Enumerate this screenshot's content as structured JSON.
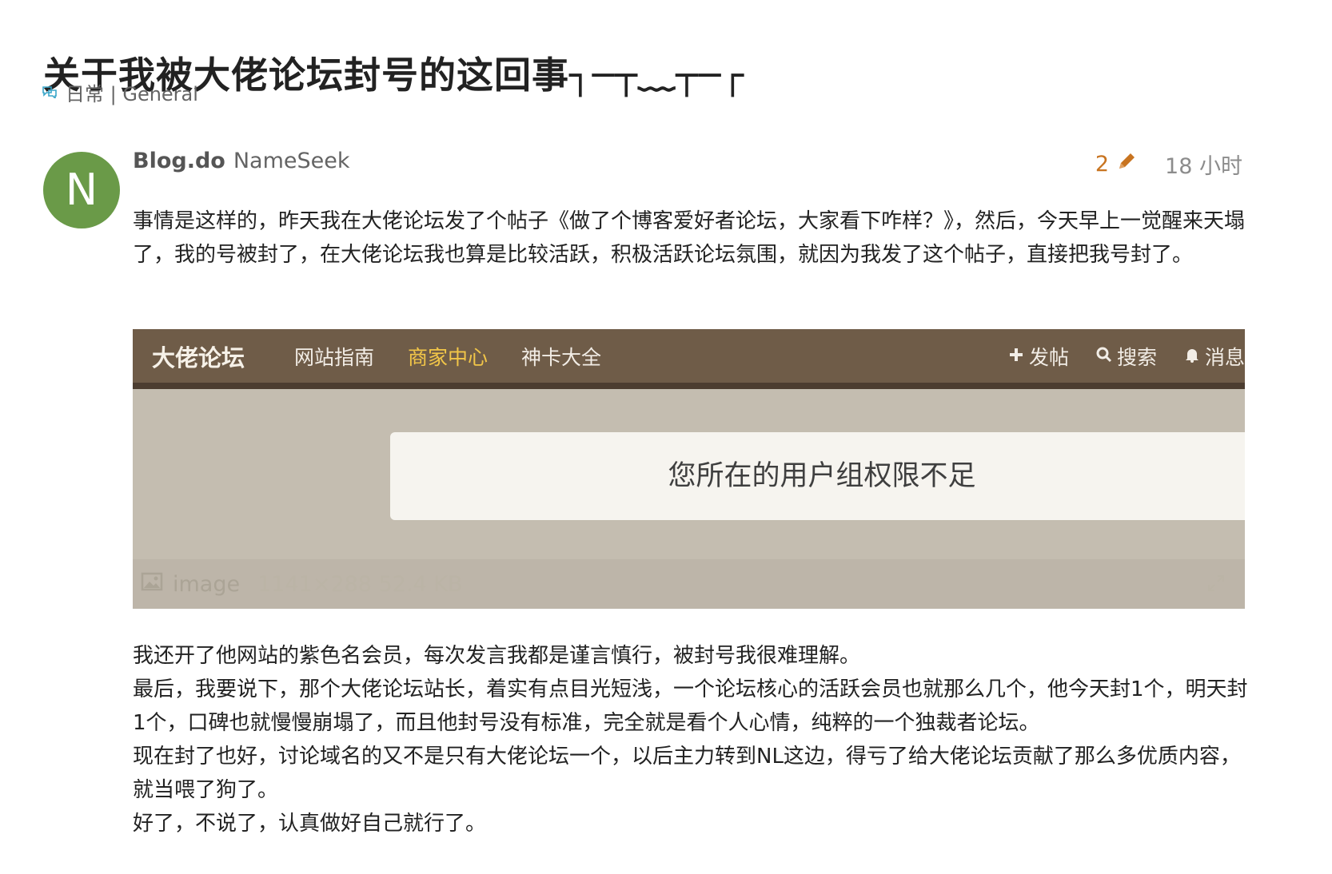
{
  "topic": {
    "title": "关于我被大佬论坛封号的这回事┐─┬﹏┬─┌",
    "category_icon": "chat-bubbles-icon",
    "category": "日常 | General"
  },
  "post": {
    "avatar_letter": "N",
    "avatar_color": "#6a9a48",
    "username": "Blog.do",
    "display_name": "NameSeek",
    "edit_count": "2",
    "edit_icon": "pencil-icon",
    "edit_color": "#c87420",
    "age": "18 小时",
    "paragraph_1": "事情是这样的，昨天我在大佬论坛发了个帖子《做了个博客爱好者论坛，大家看下咋样？》，然后，今天早上一觉醒来天塌了，我的号被封了，在大佬论坛我也算是比较活跃，积极活跃论坛氛围，就因为我发了这个帖子，直接把我号封了。",
    "image": {
      "forum_logo": "大佬论坛",
      "nav": [
        "网站指南",
        "商家中心",
        "神卡大全"
      ],
      "active_nav_color": "#f2c648",
      "actions": {
        "post": "发帖",
        "search": "搜索",
        "messages": "消息"
      },
      "message": "您所在的用户组权限不足",
      "meta_label": "image",
      "meta_size": "1141×288 52.4 KB"
    },
    "paragraph_2": [
      "我还开了他网站的紫色名会员，每次发言我都是谨言慎行，被封号我很难理解。",
      "最后，我要说下，那个大佬论坛站长，着实有点目光短浅，一个论坛核心的活跃会员也就那么几个，他今天封1个，明天封1个，口碑也就慢慢崩塌了，而且他封号没有标准，完全就是看个人心情，纯粹的一个独裁者论坛。",
      "现在封了也好，讨论域名的又不是只有大佬论坛一个，以后主力转到NL这边，得亏了给大佬论坛贡献了那么多优质内容，就当喂了狗了。",
      "好了，不说了，认真做好自己就行了。"
    ]
  }
}
